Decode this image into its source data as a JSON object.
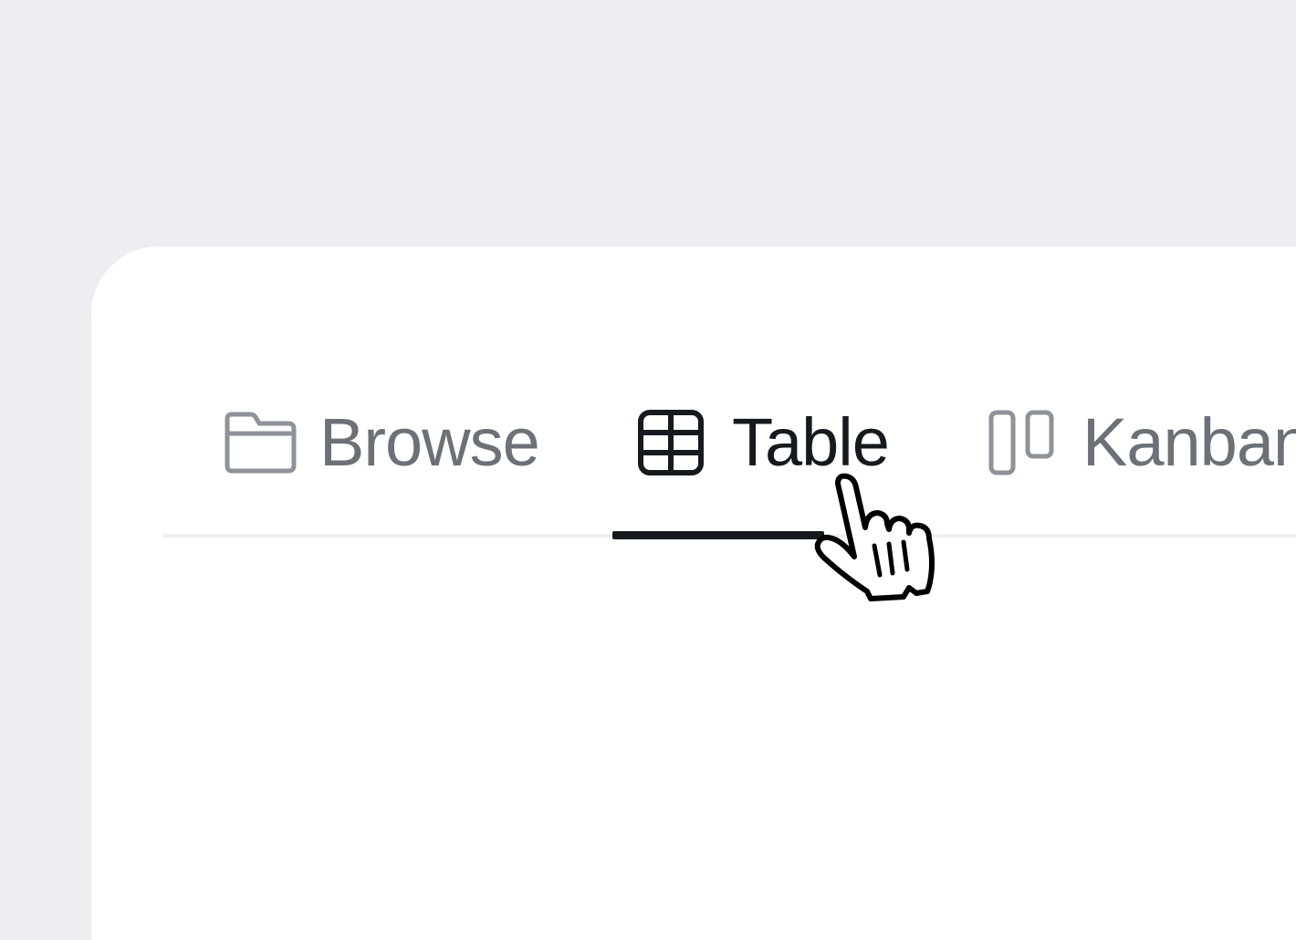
{
  "tabs": [
    {
      "id": "browse",
      "label": "Browse",
      "icon": "folder-icon",
      "active": false
    },
    {
      "id": "table",
      "label": "Table",
      "icon": "table-grid-icon",
      "active": true
    },
    {
      "id": "kanban",
      "label": "Kanban",
      "icon": "kanban-columns-icon",
      "active": false
    }
  ],
  "colors": {
    "background": "#edeef1",
    "panel": "#ffffff",
    "active_text": "#151a1e",
    "inactive_text": "#6c7177",
    "inactive_icon": "#8e9399",
    "divider": "#eef0f2"
  },
  "cursor": {
    "icon": "hand-pointer-cursor-icon"
  }
}
